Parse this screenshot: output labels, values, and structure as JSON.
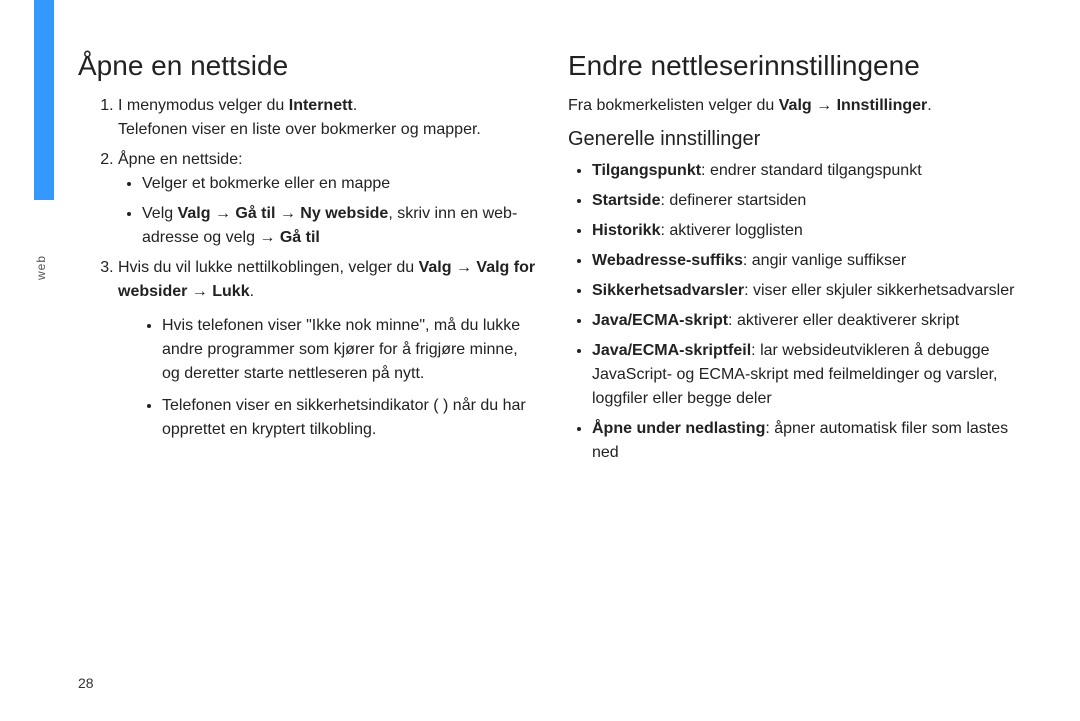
{
  "side_tab_label": "web",
  "page_number": "28",
  "left": {
    "heading": "Åpne en nettside",
    "step1_pre": "I menymodus velger du ",
    "step1_bold": "Internett",
    "step1_post": ".",
    "step1_followup": "Telefonen viser en liste over bokmerker og mapper.",
    "step2_lead": "Åpne en nettside:",
    "step2_b1": "Velger et bokmerke eller en mappe",
    "step2_b2_pre": "Velg ",
    "step2_b2_bold1": "Valg",
    "step2_b2_arrow1": " → ",
    "step2_b2_bold2": "Gå til",
    "step2_b2_arrow2": " → ",
    "step2_b2_bold3": "Ny webside",
    "step2_b2_mid": ", skriv inn en web-adresse og velg ",
    "step2_b2_arrow3": "   → ",
    "step2_b2_bold4": "Gå til",
    "step3_pre": "Hvis du vil lukke nettilkoblingen, velger du ",
    "step3_bold1": "Valg",
    "step3_arrow1": " → ",
    "step3_bold2": "Valg for websider",
    "step3_arrow2": " → ",
    "step3_bold3": "Lukk",
    "step3_post": ".",
    "note1": "Hvis telefonen viser \"Ikke nok minne\", må du lukke andre programmer som kjører for å frigjøre minne, og deretter starte nettleseren på nytt.",
    "note2": "Telefonen viser en sikkerhetsindikator (   ) når du har opprettet en kryptert tilkobling."
  },
  "right": {
    "heading": "Endre nettleserinnstillingene",
    "intro_pre": "Fra bokmerkelisten velger du ",
    "intro_bold1": "Valg",
    "intro_arrow": " → ",
    "intro_bold2": "Innstillinger",
    "intro_post": ".",
    "subheading": "Generelle innstillinger",
    "items": {
      "i0b": "Tilgangspunkt",
      "i0t": ": endrer standard tilgangspunkt",
      "i1b": "Startside",
      "i1t": ": definerer startsiden",
      "i2b": "Historikk",
      "i2t": ": aktiverer logglisten",
      "i3b": "Webadresse-suffiks",
      "i3t": ": angir vanlige suffikser",
      "i4b": "Sikkerhetsadvarsler",
      "i4t": ": viser eller skjuler sikkerhetsadvarsler",
      "i5b": "Java/ECMA-skript",
      "i5t": ": aktiverer eller deaktiverer skript",
      "i6b": "Java/ECMA-skriptfeil",
      "i6t": ": lar websideutvikleren å debugge JavaScript- og ECMA-skript med feilmeldinger og varsler, loggfiler eller begge deler",
      "i7b": "Åpne under nedlasting",
      "i7t": ": åpner automatisk filer som lastes ned"
    }
  }
}
